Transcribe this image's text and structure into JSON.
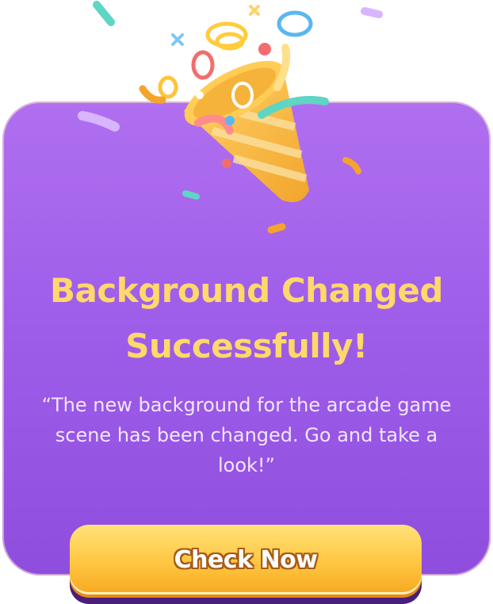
{
  "dialog": {
    "title": "Background Changed Successfully!",
    "message": "“The new background for the arcade game scene has been changed. Go and take a look!”",
    "button_label": "Check Now",
    "icon": "party-popper-icon"
  },
  "colors": {
    "card_top": "#b06ff0",
    "card_bottom": "#8f4dde",
    "title": "#ffd86a",
    "message": "#f1e6ff",
    "button": "#ffc640",
    "button_text_outline": "#a85a14"
  }
}
